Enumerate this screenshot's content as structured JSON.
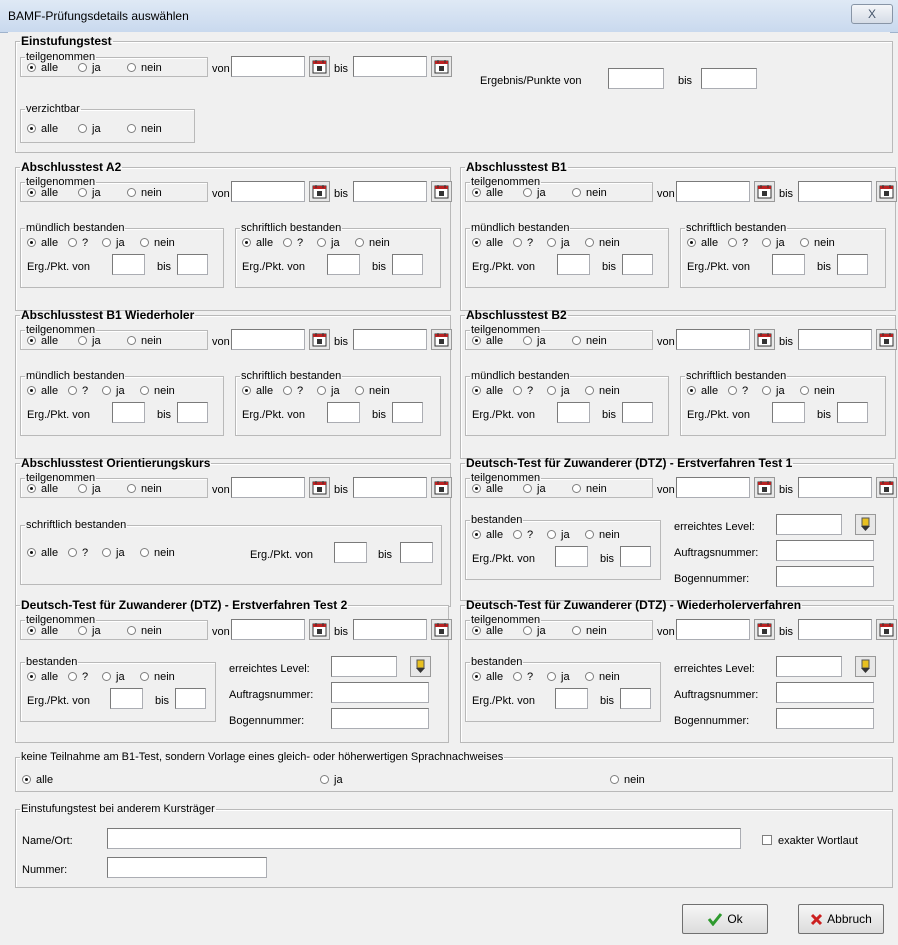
{
  "window": {
    "title": "BAMF-Prüfungsdetails auswählen",
    "close_glyph": "X"
  },
  "common": {
    "teilgenommen": "teilgenommen",
    "verzichtbar": "verzichtbar",
    "alle": "alle",
    "ja": "ja",
    "nein": "nein",
    "unknown": "?",
    "von": "von",
    "bis": "bis",
    "muendlich": "mündlich bestanden",
    "schriftlich": "schriftlich bestanden",
    "bestanden": "bestanden",
    "erg_pkt_von": "Erg./Pkt. von",
    "ergebnis_punkte_von": "Ergebnis/Punkte  von",
    "erreichtes_level": "erreichtes Level:",
    "auftragsnummer": "Auftragsnummer:",
    "bogennummer": "Bogennummer:"
  },
  "sections": {
    "einstufungstest": "Einstufungstest",
    "a2": "Abschlusstest A2",
    "b1": "Abschlusstest B1",
    "b1w": "Abschlusstest B1 Wiederholer",
    "b2": "Abschlusstest B2",
    "ok": "Abschlusstest Orientierungskurs",
    "dtz1": "Deutsch-Test für Zuwanderer (DTZ) - Erstverfahren Test 1",
    "dtz2": "Deutsch-Test für Zuwanderer (DTZ) - Erstverfahren Test 2",
    "dtzw": "Deutsch-Test für Zuwanderer (DTZ) - Wiederholerverfahren"
  },
  "keine_teilnahme": {
    "label": "keine Teilnahme am B1-Test, sondern Vorlage eines gleich- oder höherwertigen Sprachnachweises",
    "options": [
      "alle",
      "ja",
      "nein"
    ],
    "selected": "alle"
  },
  "anderer_kurstraeger": {
    "label": "Einstufungstest bei anderem Kursträger",
    "name_ort_label": "Name/Ort:",
    "name_ort_value": "",
    "nummer_label": "Nummer:",
    "nummer_value": "",
    "exakter_wortlaut": "exakter Wortlaut",
    "exakter_wortlaut_checked": false
  },
  "buttons": {
    "ok": "Ok",
    "abbruch": "Abbruch"
  },
  "icons": {
    "calendar": "calendar-icon",
    "level": "level-picker-icon",
    "ok": "checkmark-icon",
    "cancel": "red-x-icon"
  },
  "colors": {
    "ok_check": "#2e9a2e",
    "cancel_x": "#cc2020",
    "titlebar": "#c9d9ee"
  }
}
